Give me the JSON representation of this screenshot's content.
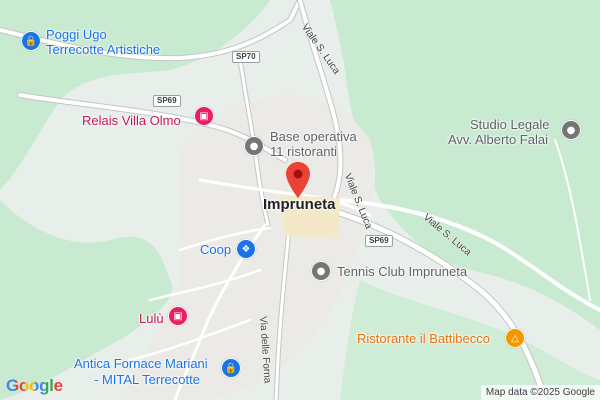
{
  "map": {
    "town": "Impruneta",
    "pins": {
      "poggi_ugo": {
        "line1": "Poggi Ugo",
        "line2": "Terrecotte Artistiche",
        "icon": "shopping-bag-icon",
        "color": "#1a73e8"
      },
      "relais": {
        "label": "Relais Villa Olmo",
        "icon": "bed-icon",
        "color": "#e91e63"
      },
      "base_operativa": {
        "line1": "Base operativa",
        "line2": "11 ristoranti",
        "icon": "place-icon",
        "color": "#757575"
      },
      "studio_legale": {
        "line1": "Studio Legale",
        "line2": "Avv. Alberto Falai",
        "icon": "place-icon",
        "color": "#757575"
      },
      "coop": {
        "label": "Coop",
        "icon": "cart-icon",
        "color": "#1a73e8"
      },
      "tennis": {
        "label": "Tennis Club Impruneta",
        "icon": "place-icon",
        "color": "#757575"
      },
      "lulu": {
        "label": "Lulù",
        "icon": "bed-icon",
        "color": "#e91e63"
      },
      "ristorante": {
        "label": "Ristorante il Battibecco",
        "icon": "fork-knife-icon",
        "color": "#f29900"
      },
      "antica_fornace": {
        "line1": "Antica Fornace Mariani",
        "line2": "- MITAL Terrecotte",
        "icon": "shopping-bag-icon",
        "color": "#1a73e8"
      }
    },
    "roads": {
      "sp70": "SP70",
      "sp69_west": "SP69",
      "sp69_east": "SP69",
      "viale_san_luca_north": "Viale S. Luca",
      "viale_san_luca_center": "Viale S. Luca",
      "viale_san_luca_east": "Viale S. Luca",
      "via_delle_fornaci": "Via delle Forna"
    },
    "google_logo": "Google",
    "attribution": "Map data ©2025 Google",
    "colors": {
      "marker": "#ea4335",
      "land": "#e8eee9",
      "forest": "#c7ead0",
      "roads": "#ffffff"
    }
  }
}
